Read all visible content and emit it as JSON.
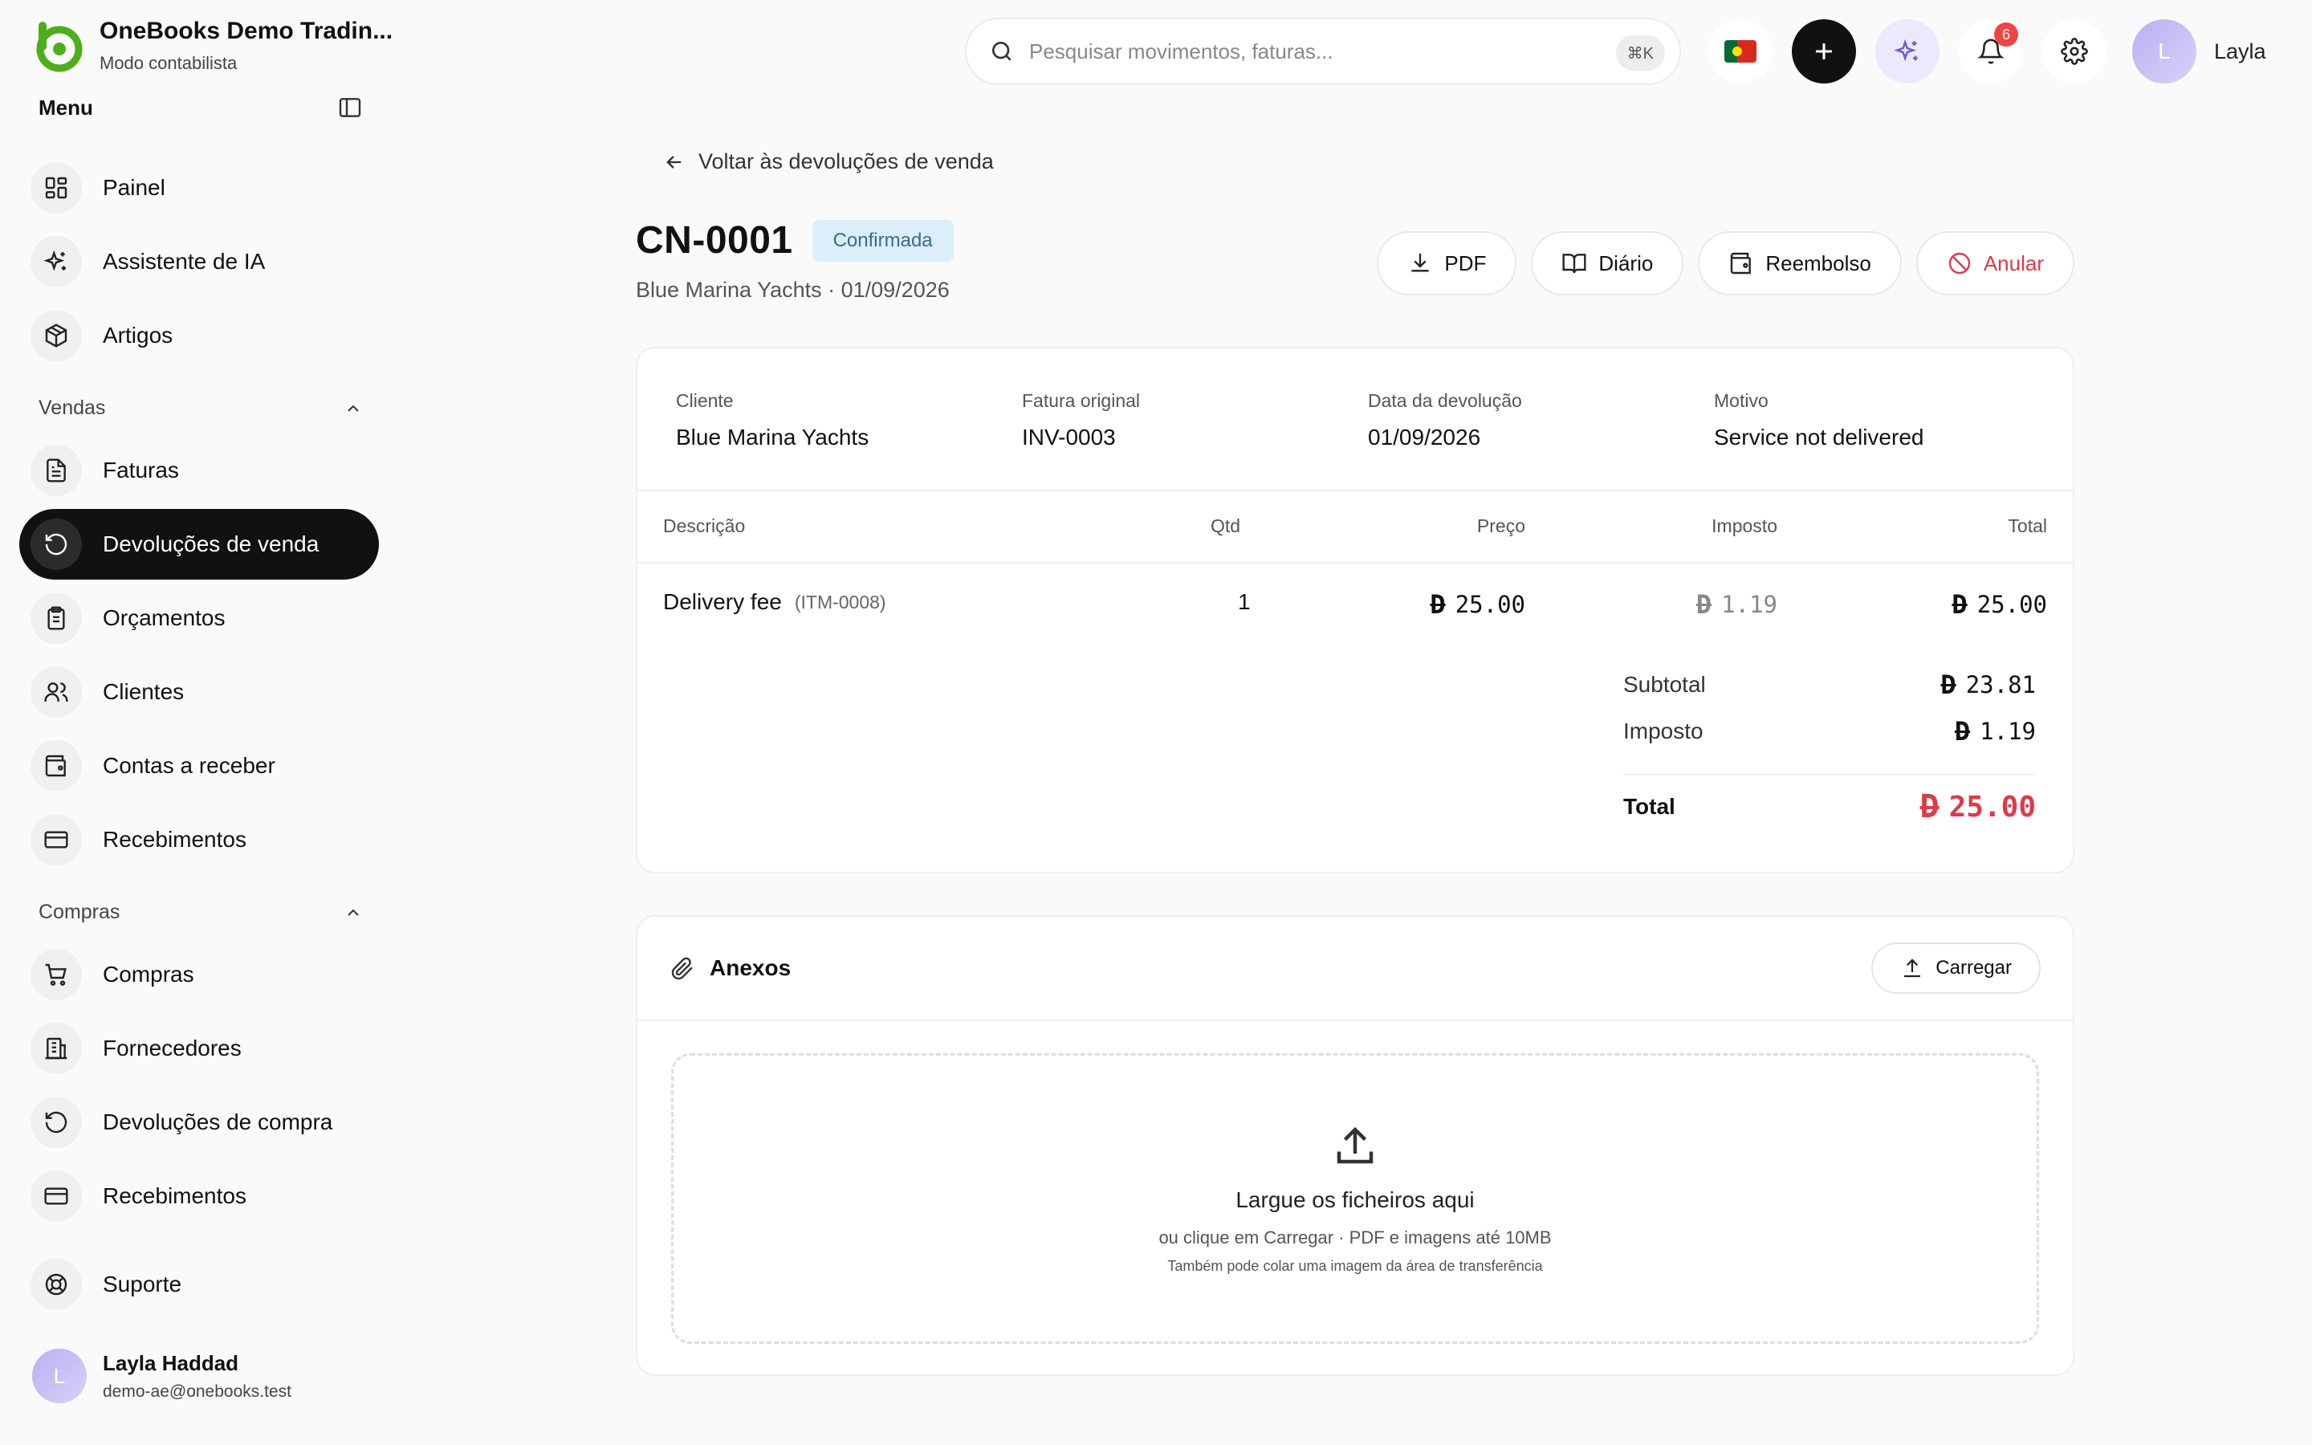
{
  "brand": {
    "name": "OneBooks Demo Tradin...",
    "mode": "Modo contabilista"
  },
  "sidebar": {
    "menu_title": "Menu",
    "top_items": [
      {
        "label": "Painel",
        "icon": "dashboard-icon"
      },
      {
        "label": "Assistente de IA",
        "icon": "sparkles-icon"
      },
      {
        "label": "Artigos",
        "icon": "box-icon"
      }
    ],
    "sales": {
      "title": "Vendas",
      "items": [
        {
          "label": "Faturas",
          "icon": "file-icon"
        },
        {
          "label": "Devoluções de venda",
          "icon": "return-icon",
          "active": true
        },
        {
          "label": "Orçamentos",
          "icon": "clipboard-icon"
        },
        {
          "label": "Clientes",
          "icon": "users-icon"
        },
        {
          "label": "Contas a receber",
          "icon": "wallet-icon"
        },
        {
          "label": "Recebimentos",
          "icon": "card-icon"
        }
      ]
    },
    "purchases": {
      "title": "Compras",
      "items": [
        {
          "label": "Compras",
          "icon": "cart-icon"
        },
        {
          "label": "Fornecedores",
          "icon": "building-icon"
        },
        {
          "label": "Devoluções de compra",
          "icon": "return-icon"
        },
        {
          "label": "Recebimentos",
          "icon": "card-icon"
        }
      ]
    },
    "support": {
      "label": "Suporte",
      "icon": "lifebuoy-icon"
    },
    "user": {
      "initial": "L",
      "name": "Layla Haddad",
      "email": "demo-ae@onebooks.test"
    }
  },
  "topbar": {
    "search_placeholder": "Pesquisar movimentos, faturas...",
    "shortcut": "⌘K",
    "notifications_count": "6",
    "user_initial": "L",
    "user_name": "Layla"
  },
  "page": {
    "back_label": "Voltar às devoluções de venda",
    "doc_number": "CN-0001",
    "status": "Confirmada",
    "subtitle": "Blue Marina Yachts · 01/09/2026",
    "actions": {
      "pdf": "PDF",
      "journal": "Diário",
      "refund": "Reembolso",
      "void": "Anular"
    },
    "meta": [
      {
        "key": "Cliente",
        "value": "Blue Marina Yachts"
      },
      {
        "key": "Fatura original",
        "value": "INV-0003"
      },
      {
        "key": "Data da devolução",
        "value": "01/09/2026"
      },
      {
        "key": "Motivo",
        "value": "Service not delivered"
      }
    ],
    "table": {
      "columns": [
        "Descrição",
        "Qtd",
        "Preço",
        "Imposto",
        "Total"
      ],
      "rows": [
        {
          "description": "Delivery fee",
          "code": "(ITM-0008)",
          "qty": "1",
          "price": "25.00",
          "tax": "1.19",
          "total": "25.00"
        }
      ]
    },
    "currency_symbol": "D",
    "totals": {
      "subtotal_label": "Subtotal",
      "subtotal": "23.81",
      "tax_label": "Imposto",
      "tax": "1.19",
      "total_label": "Total",
      "total": "25.00"
    },
    "attachments": {
      "title": "Anexos",
      "upload_label": "Carregar",
      "drop_title": "Largue os ficheiros aqui",
      "drop_sub": "ou clique em Carregar · PDF e imagens até 10MB",
      "drop_note": "Também pode colar uma imagem da área de transferência"
    }
  },
  "colors": {
    "accent": "#111111",
    "brand_green": "#4caf1a",
    "danger": "#dc3b4a",
    "status_bg": "#dbeefa"
  }
}
